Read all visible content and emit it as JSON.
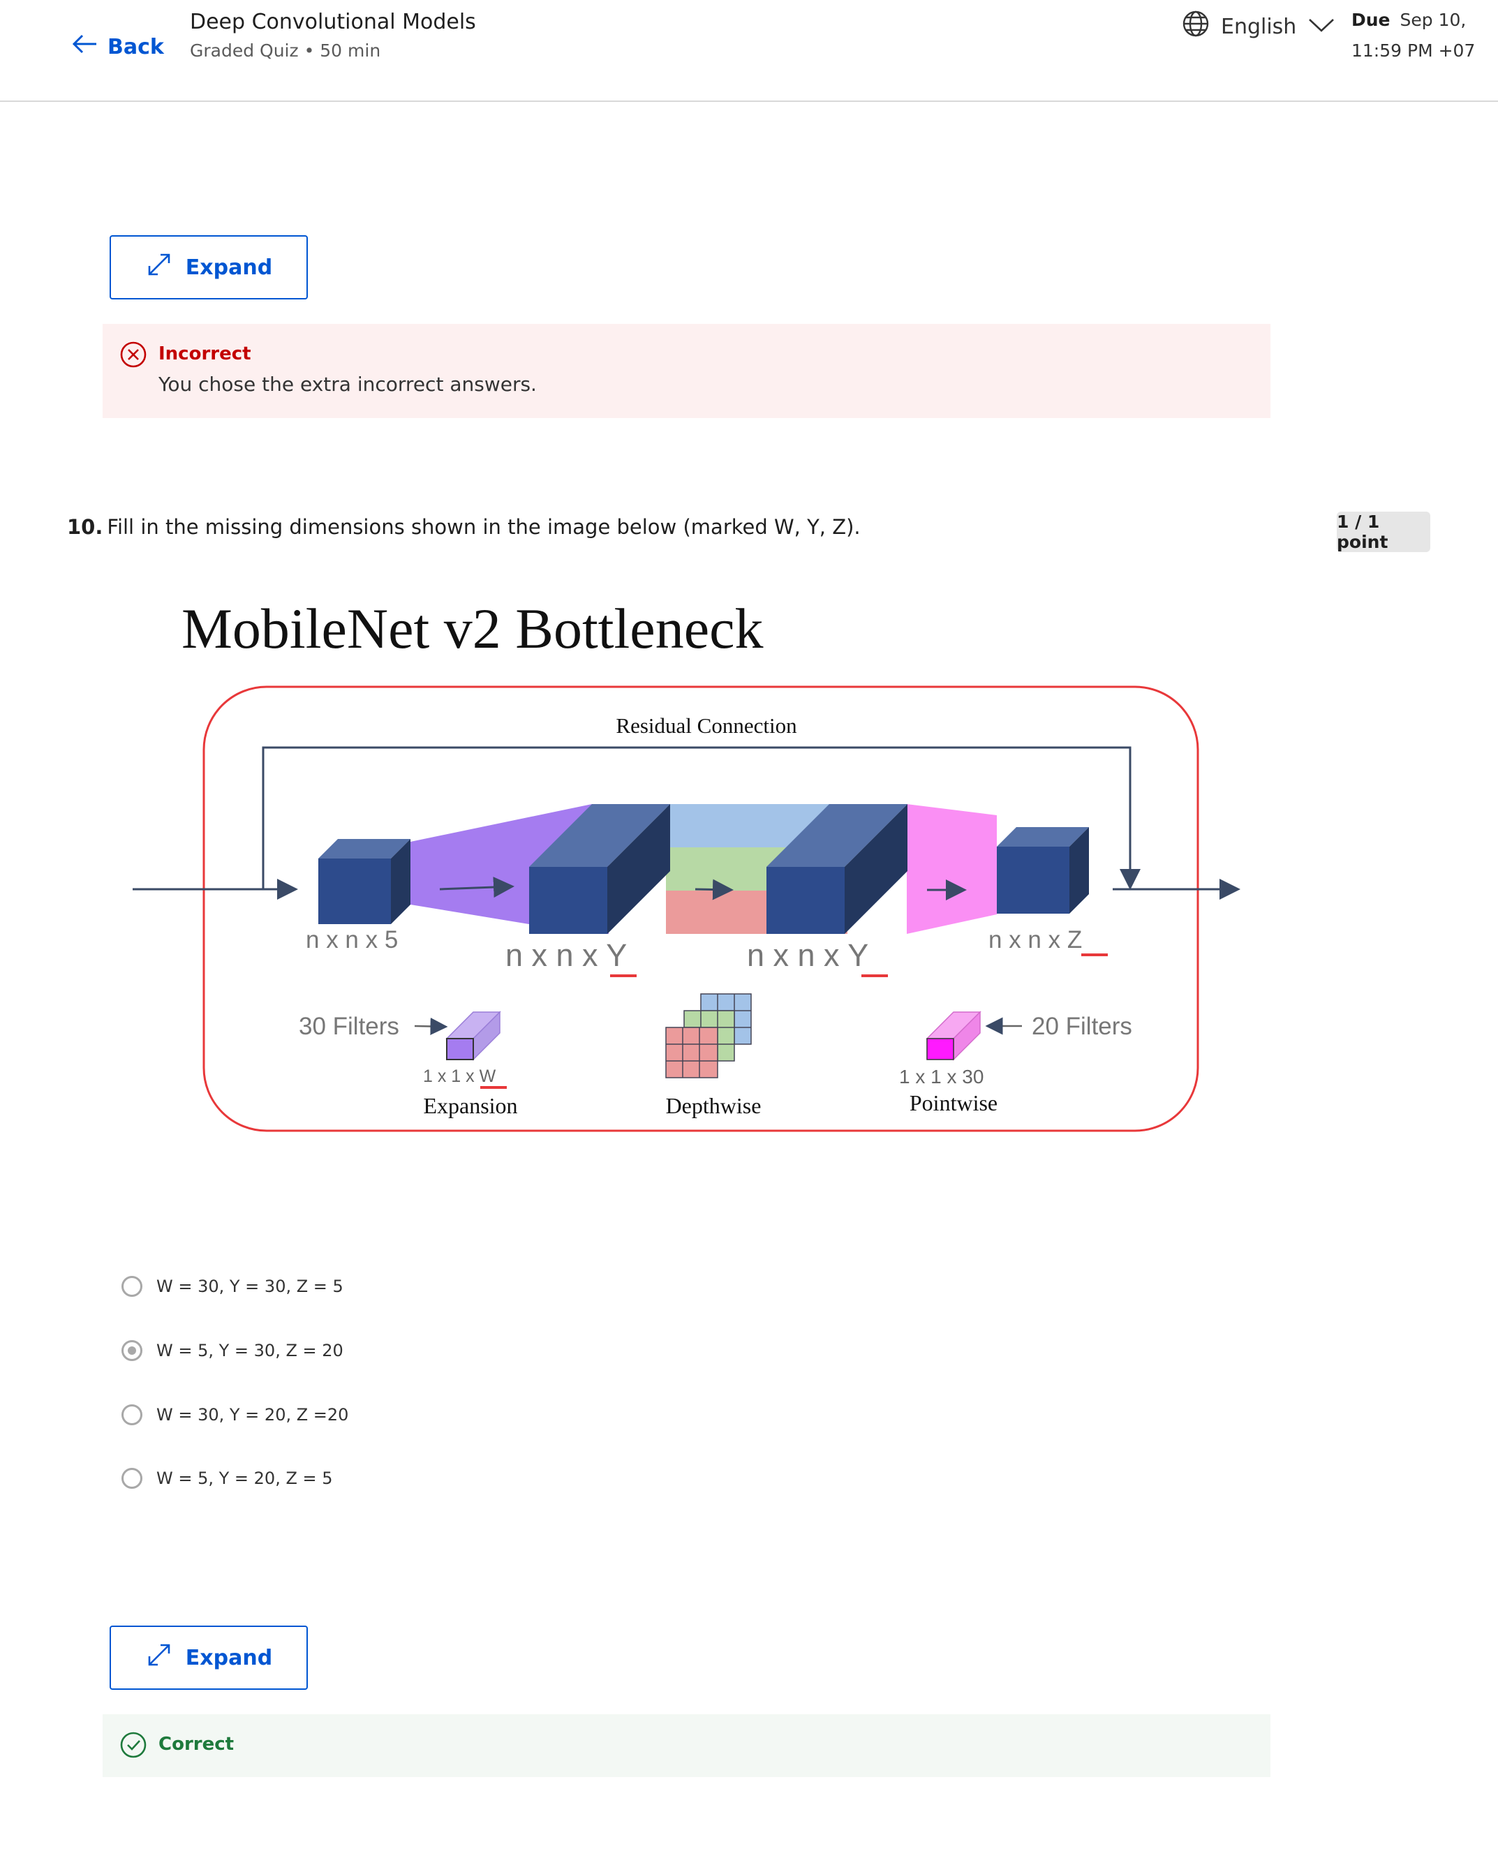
{
  "header": {
    "back_label": "Back",
    "course_title": "Deep Convolutional Models",
    "course_subtitle": "Graded Quiz • 50 min",
    "language": "English",
    "due_label": "Due",
    "due_date": "Sep 10,",
    "due_time": "11:59 PM +07"
  },
  "expand_label": "Expand",
  "feedback_incorrect": {
    "title": "Incorrect",
    "text": "You chose the extra incorrect answers.",
    "color": "#c30000"
  },
  "feedback_correct": {
    "title": "Correct",
    "color": "#1e7a3c"
  },
  "question": {
    "number": "10.",
    "text": "Fill in the missing dimensions shown in the image below (marked W, Y, Z).",
    "points": "1 / 1 point"
  },
  "figure": {
    "title": "MobileNet v2 Bottleneck",
    "residual_label": "Residual Connection",
    "input_dim": "n x n x 5",
    "expanded_dim_prefix": "n x n x ",
    "expanded_dim_var": "Y",
    "depthwise_dim_prefix": "n x n x ",
    "depthwise_dim_var": "Y",
    "output_dim_prefix": "n x n x ",
    "output_dim_var": "Z",
    "expansion_filters": "30 Filters",
    "expansion_kernel_prefix": "1 x 1 x ",
    "expansion_kernel_var": "W",
    "expansion_label": "Expansion",
    "depthwise_label": "Depthwise",
    "pointwise_filters": "20 Filters",
    "pointwise_kernel": "1 x 1 x 30",
    "pointwise_label": "Pointwise"
  },
  "options": [
    {
      "label": "W = 30, Y = 30, Z = 5",
      "selected": false
    },
    {
      "label": "W = 5, Y = 30, Z = 20",
      "selected": true
    },
    {
      "label": "W = 30, Y = 20, Z =20",
      "selected": false
    },
    {
      "label": "W = 5, Y = 20, Z = 5",
      "selected": false
    }
  ],
  "colors": {
    "accent": "#0056d2",
    "incorrect_bg": "#fdf0f0",
    "correct_bg": "#f3f8f4"
  }
}
